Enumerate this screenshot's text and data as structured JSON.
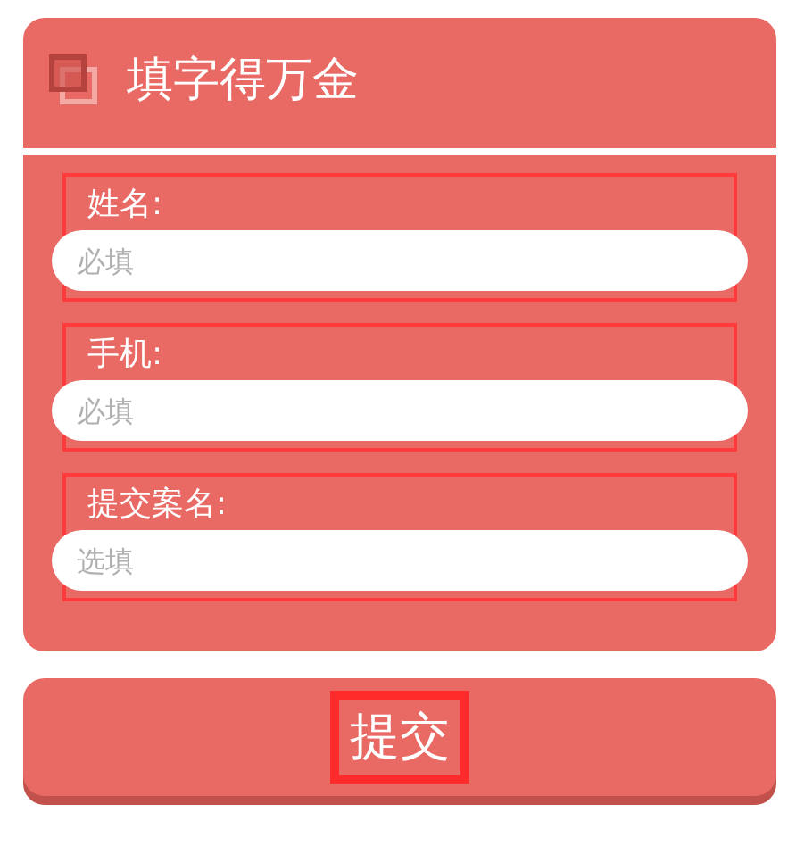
{
  "header": {
    "title": "填字得万金"
  },
  "fields": [
    {
      "label": "姓名:",
      "placeholder": "必填"
    },
    {
      "label": "手机:",
      "placeholder": "必填"
    },
    {
      "label": "提交案名:",
      "placeholder": "选填"
    }
  ],
  "submit": {
    "label": "提交"
  }
}
